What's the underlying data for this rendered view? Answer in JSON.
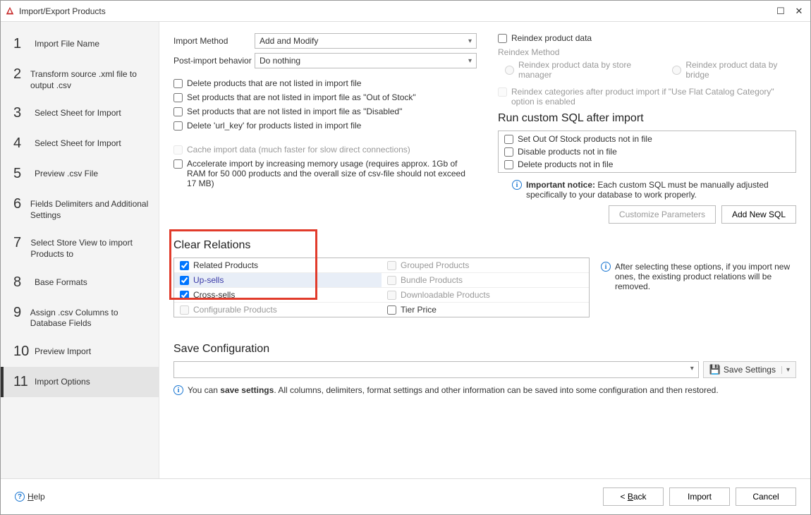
{
  "title": "Import/Export Products",
  "steps": [
    {
      "num": "1",
      "label": "Import File Name"
    },
    {
      "num": "2",
      "label": "Transform source .xml file to output .csv"
    },
    {
      "num": "3",
      "label": "Select Sheet for Import"
    },
    {
      "num": "4",
      "label": "Select Sheet for Import"
    },
    {
      "num": "5",
      "label": "Preview .csv File"
    },
    {
      "num": "6",
      "label": "Fields Delimiters and Additional Settings"
    },
    {
      "num": "7",
      "label": "Select Store View to import Products to"
    },
    {
      "num": "8",
      "label": "Base Formats"
    },
    {
      "num": "9",
      "label": "Assign .csv Columns to Database Fields"
    },
    {
      "num": "10",
      "label": "Preview Import"
    },
    {
      "num": "11",
      "label": "Import Options"
    }
  ],
  "activeStep": 10,
  "left": {
    "importMethodLabel": "Import Method",
    "importMethodValue": "Add and Modify",
    "postImportLabel": "Post-import behavior",
    "postImportValue": "Do nothing",
    "chkDelete": "Delete products that are not listed in import file",
    "chkOutOfStock": "Set products that are not listed in import file as \"Out of Stock\"",
    "chkDisabled": "Set products that are not listed in import file as \"Disabled\"",
    "chkDeleteUrl": "Delete 'url_key' for products listed in import file",
    "chkCache": "Cache import data (much faster for slow direct connections)",
    "chkAccel": "Accelerate import by increasing memory usage (requires approx. 1Gb of RAM for 50 000 products and the overall size of csv-file should not exceed 17 MB)"
  },
  "right": {
    "chkReindex": "Reindex product data",
    "reindexMethodLabel": "Reindex Method",
    "radStoreMgr": "Reindex product data by store manager",
    "radBridge": "Reindex product data by bridge",
    "chkReindexCat": "Reindex categories after product import if \"Use Flat Catalog Category\" option is enabled",
    "sqlHeader": "Run custom SQL after import",
    "sql1": "Set Out Of Stock products not in file",
    "sql2": "Disable products not in file",
    "sql3": "Delete products not in file",
    "noticeLabel": "Important notice:",
    "noticeText": " Each custom SQL must be manually adjusted specifically to your database to work properly.",
    "btnCustomize": "Customize Parameters",
    "btnAddSQL": "Add New SQL"
  },
  "clearRel": {
    "header": "Clear Relations",
    "c1a": "Related Products",
    "c1b": "Up-sells",
    "c1c": "Cross-sells",
    "c1d": "Configurable Products",
    "c2a": "Grouped Products",
    "c2b": "Bundle Products",
    "c2c": "Downloadable Products",
    "c2d": "Tier Price",
    "info": "After selecting these options, if you import new ones, the existing product relations will be removed."
  },
  "saveCfg": {
    "header": "Save Configuration",
    "btnSave": "Save Settings",
    "info1": "You can ",
    "infoBold": "save settings",
    "info2": ". All columns, delimiters, format settings and other information can be saved into some configuration and then restored."
  },
  "bottom": {
    "help": "Help",
    "back": "Back",
    "import": "Import",
    "cancel": "Cancel"
  }
}
